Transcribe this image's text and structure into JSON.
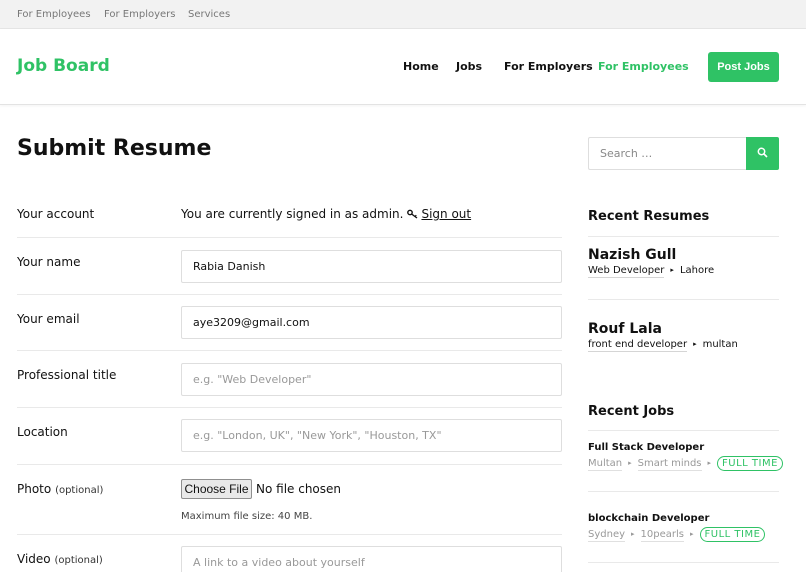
{
  "topbar": {
    "links": [
      "For Employees",
      "For Employers",
      "Services"
    ]
  },
  "header": {
    "logo": "Job Board",
    "nav": [
      "Home",
      "Jobs",
      "For Employers",
      "For Employees"
    ],
    "active_nav": "For Employees",
    "post_button": "Post Jobs"
  },
  "main": {
    "title": "Submit Resume",
    "account": {
      "label": "Your account",
      "text": "You are currently signed in as admin.",
      "signout": "Sign out"
    },
    "fields": {
      "name": {
        "label": "Your name",
        "value": "Rabia Danish"
      },
      "email": {
        "label": "Your email",
        "value": "aye3209@gmail.com"
      },
      "title": {
        "label": "Professional title",
        "placeholder": "e.g. \"Web Developer\""
      },
      "location": {
        "label": "Location",
        "placeholder": "e.g. \"London, UK\", \"New York\", \"Houston, TX\""
      },
      "photo": {
        "label": "Photo",
        "optional": "(optional)",
        "button": "Choose File",
        "status": "No file chosen",
        "hint": "Maximum file size: 40 MB."
      },
      "video": {
        "label": "Video",
        "optional": "(optional)",
        "placeholder": "A link to a video about yourself"
      }
    }
  },
  "sidebar": {
    "search": {
      "placeholder": "Search …"
    },
    "recent_resumes": {
      "heading": "Recent Resumes",
      "items": [
        {
          "name": "Nazish Gull",
          "title": "Web Developer",
          "location": "Lahore"
        },
        {
          "name": "Rouf Lala",
          "title": "front end developer",
          "location": "multan"
        }
      ]
    },
    "recent_jobs": {
      "heading": "Recent Jobs",
      "items": [
        {
          "title": "Full Stack Developer",
          "location": "Multan",
          "company": "Smart minds",
          "type": "FULL TIME"
        },
        {
          "title": "blockchain Developer",
          "location": "Sydney",
          "company": "10pearls",
          "type": "FULL TIME"
        }
      ]
    }
  },
  "colors": {
    "accent": "#2fc265",
    "topbar_bg": "#f2f2f2",
    "text": "#111111"
  }
}
